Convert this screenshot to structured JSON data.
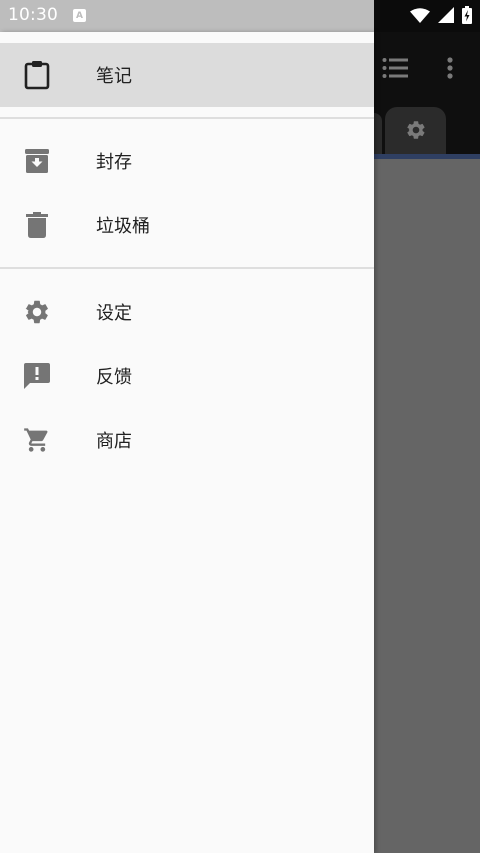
{
  "status_bar": {
    "time": "10:30",
    "notification_badge": "A",
    "icons": [
      "wifi-icon",
      "signal-icon",
      "battery-charging-icon"
    ]
  },
  "background_app": {
    "toolbar_icons": [
      "list-view-icon",
      "more-vert-icon"
    ],
    "tab_icon": "settings-icon"
  },
  "drawer": {
    "groups": [
      [
        {
          "id": "notes",
          "label": "笔记",
          "icon": "clipboard-icon",
          "selected": true
        }
      ],
      [
        {
          "id": "archive",
          "label": "封存",
          "icon": "archive-icon",
          "selected": false
        },
        {
          "id": "trash",
          "label": "垃圾桶",
          "icon": "trash-icon",
          "selected": false
        }
      ],
      [
        {
          "id": "settings",
          "label": "设定",
          "icon": "settings-icon",
          "selected": false
        },
        {
          "id": "feedback",
          "label": "反馈",
          "icon": "feedback-icon",
          "selected": false
        },
        {
          "id": "store",
          "label": "商店",
          "icon": "cart-icon",
          "selected": false
        }
      ]
    ]
  },
  "colors": {
    "drawer_bg": "#fafafa",
    "selected_bg": "#dcdcdc",
    "icon_gray": "#757575",
    "scrim": "#656565"
  }
}
